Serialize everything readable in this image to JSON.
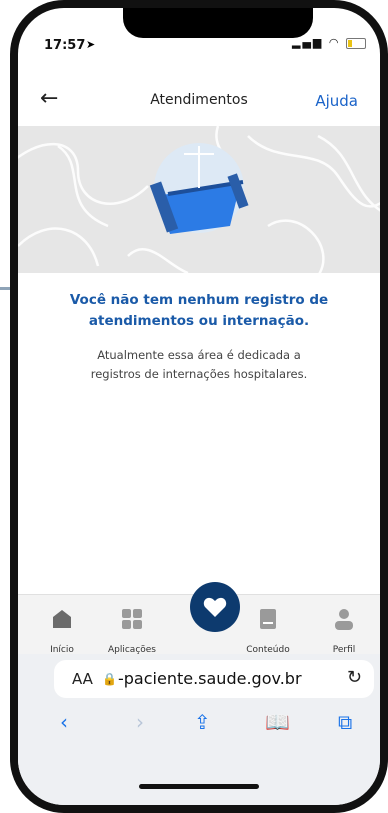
{
  "status": {
    "time": "17:57"
  },
  "header": {
    "title": "Atendimentos",
    "help": "Ajuda",
    "back_icon": "arrow-left-icon"
  },
  "empty_state": {
    "heading_line1": "Você não tem nenhum registro de",
    "heading_line2": "atendimentos ou internação.",
    "desc_line1": "Atualmente essa área é dedicada a",
    "desc_line2": "registros de internações hospitalares."
  },
  "tabs": [
    {
      "label": "Início",
      "icon": "home-icon"
    },
    {
      "label": "Aplicações",
      "icon": "grid-icon"
    },
    {
      "label": "Conteúdo",
      "icon": "book-icon"
    },
    {
      "label": "Perfil",
      "icon": "person-icon"
    }
  ],
  "fab_icon": "heart-icon",
  "safari": {
    "aa": "AA",
    "url": "-paciente.saude.gov.br"
  },
  "colors": {
    "accent": "#1a5aa8",
    "fab": "#0d3a6e",
    "link": "#1a63c9"
  }
}
